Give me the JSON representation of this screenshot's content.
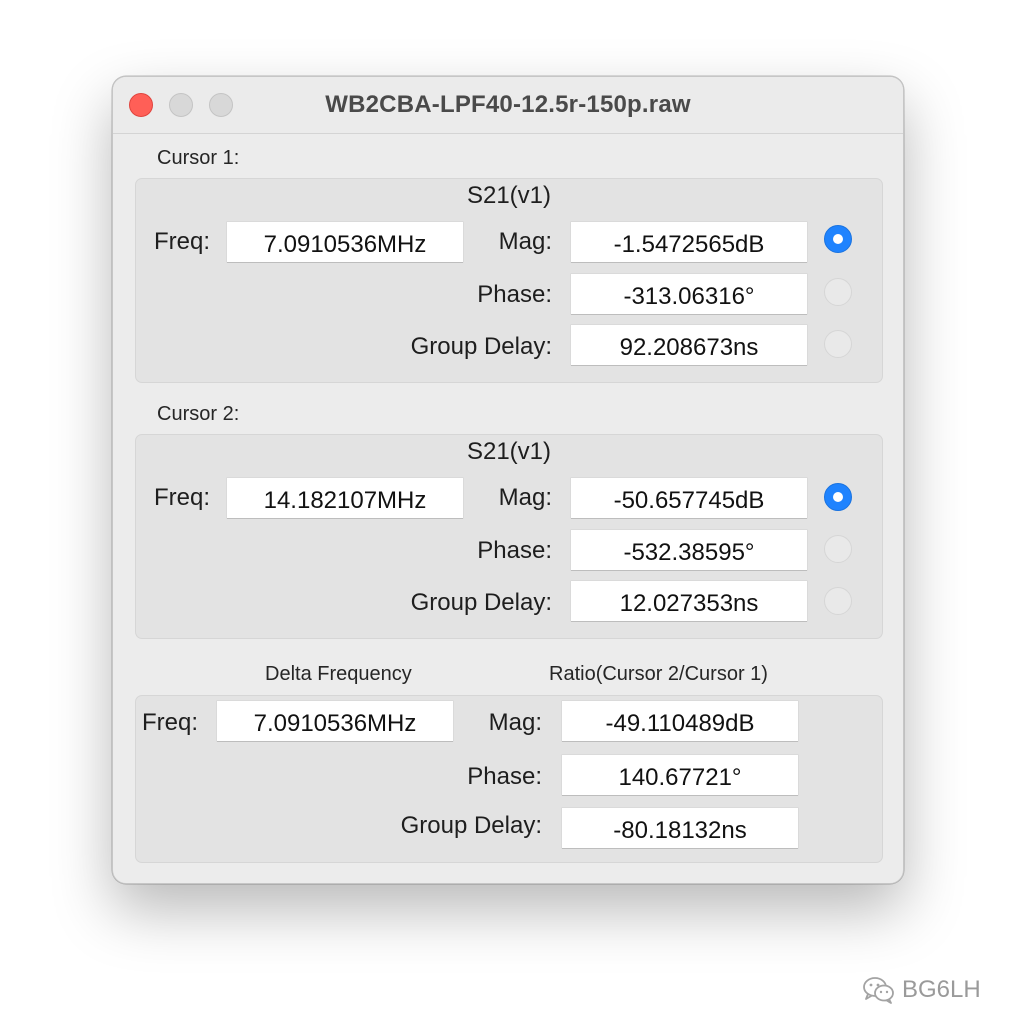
{
  "window": {
    "title": "WB2CBA-LPF40-12.5r-150p.raw"
  },
  "cursor1": {
    "label": "Cursor 1:",
    "trace": "S21(v1)",
    "freq_label": "Freq:",
    "freq": "7.0910536MHz",
    "mag_label": "Mag:",
    "mag": "-1.5472565dB",
    "phase_label": "Phase:",
    "phase": "-313.06316°",
    "gd_label": "Group Delay:",
    "gd": "92.208673ns",
    "selected": "mag"
  },
  "cursor2": {
    "label": "Cursor 2:",
    "trace": "S21(v1)",
    "freq_label": "Freq:",
    "freq": "14.182107MHz",
    "mag_label": "Mag:",
    "mag": "-50.657745dB",
    "phase_label": "Phase:",
    "phase": "-532.38595°",
    "gd_label": "Group Delay:",
    "gd": "12.027353ns",
    "selected": "mag"
  },
  "delta": {
    "delta_label": "Delta Frequency",
    "ratio_label": "Ratio(Cursor 2/Cursor 1)",
    "freq_label": "Freq:",
    "freq": "7.0910536MHz",
    "mag_label": "Mag:",
    "mag": "-49.110489dB",
    "phase_label": "Phase:",
    "phase": "140.67721°",
    "gd_label": "Group Delay:",
    "gd": "-80.18132ns"
  },
  "watermark": {
    "text": "BG6LH",
    "icon": "wechat-icon"
  },
  "colors": {
    "close": "#ff5f57",
    "accent": "#1f83fe"
  }
}
